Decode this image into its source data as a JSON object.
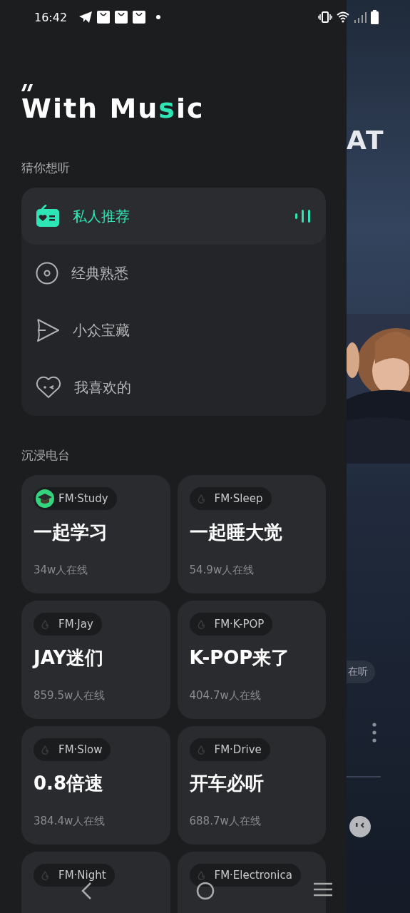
{
  "status_bar": {
    "time": "16:42"
  },
  "logo": {
    "before": "With Mu",
    "accent": "s",
    "after": "ic"
  },
  "guess_section": {
    "title": "猜你想听",
    "items": [
      {
        "label": "私人推荐",
        "kind": "radio",
        "selected": true
      },
      {
        "label": "经典熟悉",
        "kind": "disc",
        "selected": false
      },
      {
        "label": "小众宝藏",
        "kind": "send",
        "selected": false
      },
      {
        "label": "我喜欢的",
        "kind": "heart",
        "selected": false
      }
    ]
  },
  "radio_section": {
    "title": "沉浸电台",
    "cards": [
      {
        "badge": "FM·Study",
        "kind": "cap",
        "title": "一起学习",
        "listeners": "34w人在线"
      },
      {
        "badge": "FM·Sleep",
        "kind": "flame",
        "title": "一起睡大觉",
        "listeners": "54.9w人在线"
      },
      {
        "badge": "FM·Jay",
        "kind": "flame",
        "title": "JAY迷们",
        "listeners": "859.5w人在线"
      },
      {
        "badge": "FM·K-POP",
        "kind": "flame",
        "title": "K-POP来了",
        "listeners": "404.7w人在线"
      },
      {
        "badge": "FM·Slow",
        "kind": "flame",
        "title": "0.8倍速",
        "listeners": "384.4w人在线"
      },
      {
        "badge": "FM·Drive",
        "kind": "flame",
        "title": "开车必听",
        "listeners": "688.7w人在线"
      },
      {
        "badge": "FM·Night",
        "kind": "flame"
      },
      {
        "badge": "FM·Electronica",
        "kind": "flame"
      }
    ]
  },
  "background_page": {
    "title": "AT",
    "listeners_chip": "在听"
  }
}
